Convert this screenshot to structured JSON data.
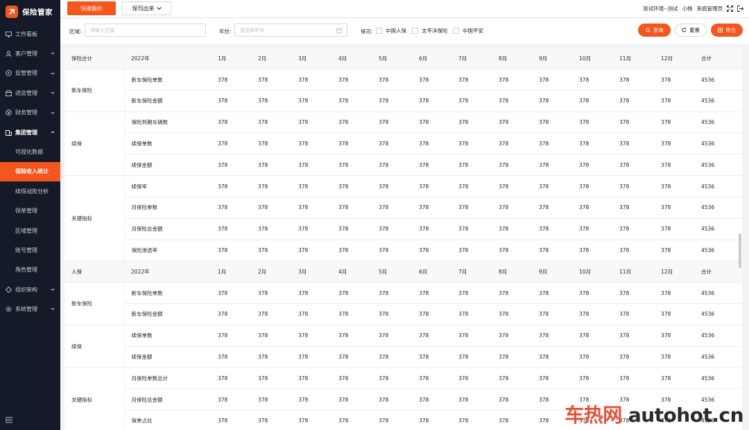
{
  "brand": {
    "title": "保险管家",
    "color": "#f5561d"
  },
  "sidebar": {
    "items": [
      {
        "label": "工作看板",
        "icon": "monitor-icon"
      },
      {
        "label": "客户管理",
        "icon": "user-icon"
      },
      {
        "label": "监管管理",
        "icon": "shield-icon"
      },
      {
        "label": "进店管理",
        "icon": "store-icon"
      },
      {
        "label": "财务管理",
        "icon": "money-icon"
      },
      {
        "label": "集团管理",
        "icon": "building-icon"
      }
    ],
    "sub_items": [
      "可视化数据",
      "保险收入统计",
      "续保战败分析",
      "保单管理",
      "区域管理",
      "账号管理",
      "角色管理"
    ],
    "active_sub": "保险收入统计",
    "bottom_items": [
      {
        "label": "组织架构",
        "icon": "org-icon"
      },
      {
        "label": "系统管理",
        "icon": "gear-icon"
      }
    ]
  },
  "header": {
    "quick_quote": "快速报价",
    "insurer_issue": "保司出单",
    "env": "测试环境--测试",
    "user": "小杨",
    "role": "系统管理员"
  },
  "filter": {
    "region_label": "区域:",
    "region_placeholder": "请输入区域",
    "year_label": "年份:",
    "year_placeholder": "请选择年份",
    "insurer_label": "保司:",
    "insurers": [
      "中国人保",
      "太平洋保险",
      "中国平安"
    ],
    "search": "查询",
    "reset": "重置",
    "export": "导出"
  },
  "table": {
    "months": [
      "1月",
      "2月",
      "3月",
      "4月",
      "5月",
      "6月",
      "7月",
      "8月",
      "9月",
      "10月",
      "11月",
      "12月"
    ],
    "total_col": "合计",
    "value": "378",
    "total_value": "4536",
    "sections": [
      {
        "name": "保险合计",
        "year": "2022年",
        "groups": [
          {
            "name": "新车保险",
            "rows": [
              "新车保险单数",
              "新车保险金额"
            ]
          },
          {
            "name": "续保",
            "rows": [
              "保险到期车辆数",
              "续保单数",
              "续保金额"
            ]
          },
          {
            "name": "关键指标",
            "rows": [
              "续保率",
              "月保险单数",
              "月保险总金额",
              "保险渗透率"
            ]
          }
        ]
      },
      {
        "name": "人保",
        "year": "2022年",
        "groups": [
          {
            "name": "新车保险",
            "rows": [
              "新车保险单数",
              "新车保险金额"
            ]
          },
          {
            "name": "续保",
            "rows": [
              "续保单数",
              "续保金额"
            ]
          },
          {
            "name": "关键指标",
            "rows": [
              "月保险单数总计",
              "月保险总金额",
              "保单占比"
            ]
          }
        ]
      }
    ]
  },
  "watermark": {
    "cn": "车热网",
    "en": "autohot.cn"
  }
}
